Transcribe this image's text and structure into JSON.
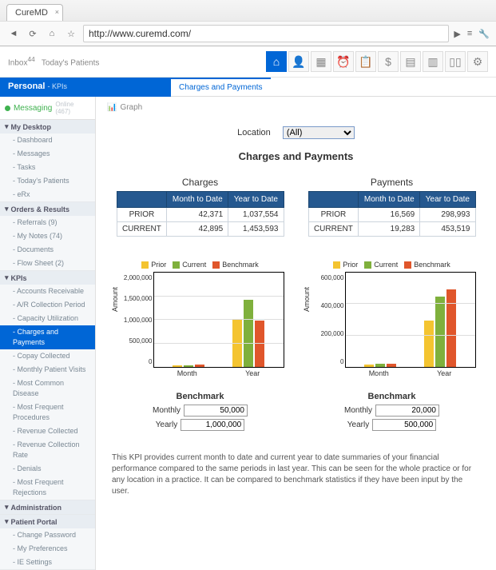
{
  "browser": {
    "tab_title": "CureMD",
    "url": "http://www.curemd.com/"
  },
  "breadcrumb": {
    "a": "Inbox",
    "b": "Today's Patients"
  },
  "toolbar_icons": [
    "home",
    "user",
    "calendar",
    "clock",
    "clipboard",
    "dollar",
    "report",
    "list",
    "columns",
    "gear"
  ],
  "bluebar": {
    "title": "Personal",
    "sub": "- KPIs"
  },
  "page_tab": "Charges and Payments",
  "graph_label": "Graph",
  "sidebar": {
    "messaging": {
      "label": "Messaging",
      "count": "Online (467)"
    },
    "groups": [
      {
        "title": "My Desktop",
        "items": [
          "Dashboard",
          "Messages",
          "Tasks",
          "Today's Patients",
          "eRx"
        ]
      },
      {
        "title": "Orders & Results",
        "items": [
          "Referrals (9)",
          "My Notes (74)",
          "Documents",
          "Flow Sheet (2)"
        ]
      },
      {
        "title": "KPIs",
        "items": [
          "Accounts Receivable",
          "A/R Collection Period",
          "Capacity Utilization",
          "Charges and Payments",
          "Copay Collected",
          "Monthly Patient Visits",
          "Most Common Disease",
          "Most Frequent Procedures",
          "Revenue Collected",
          "Revenue Collection Rate",
          "Denials",
          "Most Frequent Rejections"
        ],
        "active_index": 3
      },
      {
        "title": "Administration",
        "items": []
      },
      {
        "title": "Patient Portal",
        "items": [
          "Change Password",
          "My Preferences",
          "IE Settings"
        ]
      }
    ]
  },
  "location": {
    "label": "Location",
    "value": "(All)"
  },
  "section_title": "Charges and Payments",
  "tables": {
    "headers": [
      "",
      "Month to Date",
      "Year to Date"
    ],
    "charges": {
      "title": "Charges",
      "rows": [
        {
          "label": "PRIOR",
          "mtd": "42,371",
          "ytd": "1,037,554"
        },
        {
          "label": "CURRENT",
          "mtd": "42,895",
          "ytd": "1,453,593"
        }
      ]
    },
    "payments": {
      "title": "Payments",
      "rows": [
        {
          "label": "PRIOR",
          "mtd": "16,569",
          "ytd": "298,993"
        },
        {
          "label": "CURRENT",
          "mtd": "19,283",
          "ytd": "453,519"
        }
      ]
    }
  },
  "legend": {
    "prior": "Prior",
    "current": "Current",
    "benchmark": "Benchmark"
  },
  "xaxis": {
    "month": "Month",
    "year": "Year"
  },
  "ylabel": "Amount",
  "chart_data": [
    {
      "type": "bar",
      "title": "Charges",
      "categories": [
        "Month",
        "Year"
      ],
      "series": [
        {
          "name": "Prior",
          "values": [
            42371,
            1037554
          ]
        },
        {
          "name": "Current",
          "values": [
            42895,
            1453593
          ]
        },
        {
          "name": "Benchmark",
          "values": [
            50000,
            1000000
          ]
        }
      ],
      "ylabel": "Amount",
      "ylim": [
        0,
        2000000
      ],
      "yticks": [
        "0",
        "500,000",
        "1,000,000",
        "1,500,000",
        "2,000,000"
      ]
    },
    {
      "type": "bar",
      "title": "Payments",
      "categories": [
        "Month",
        "Year"
      ],
      "series": [
        {
          "name": "Prior",
          "values": [
            16569,
            298993
          ]
        },
        {
          "name": "Current",
          "values": [
            19283,
            453519
          ]
        },
        {
          "name": "Benchmark",
          "values": [
            20000,
            500000
          ]
        }
      ],
      "ylabel": "Amount",
      "ylim": [
        0,
        600000
      ],
      "yticks": [
        "0",
        "200,000",
        "400,000",
        "600,000"
      ]
    }
  ],
  "benchmarks": {
    "title": "Benchmark",
    "monthly_label": "Monthly",
    "yearly_label": "Yearly",
    "charges": {
      "monthly": "50,000",
      "yearly": "1,000,000"
    },
    "payments": {
      "monthly": "20,000",
      "yearly": "500,000"
    }
  },
  "description": "This KPI provides current month to date and current year to date summaries of your financial performance compared to the same periods in last year. This can be seen for the whole practice or for any location in a practice. It can be compared to benchmark statistics if they have been input by the user."
}
